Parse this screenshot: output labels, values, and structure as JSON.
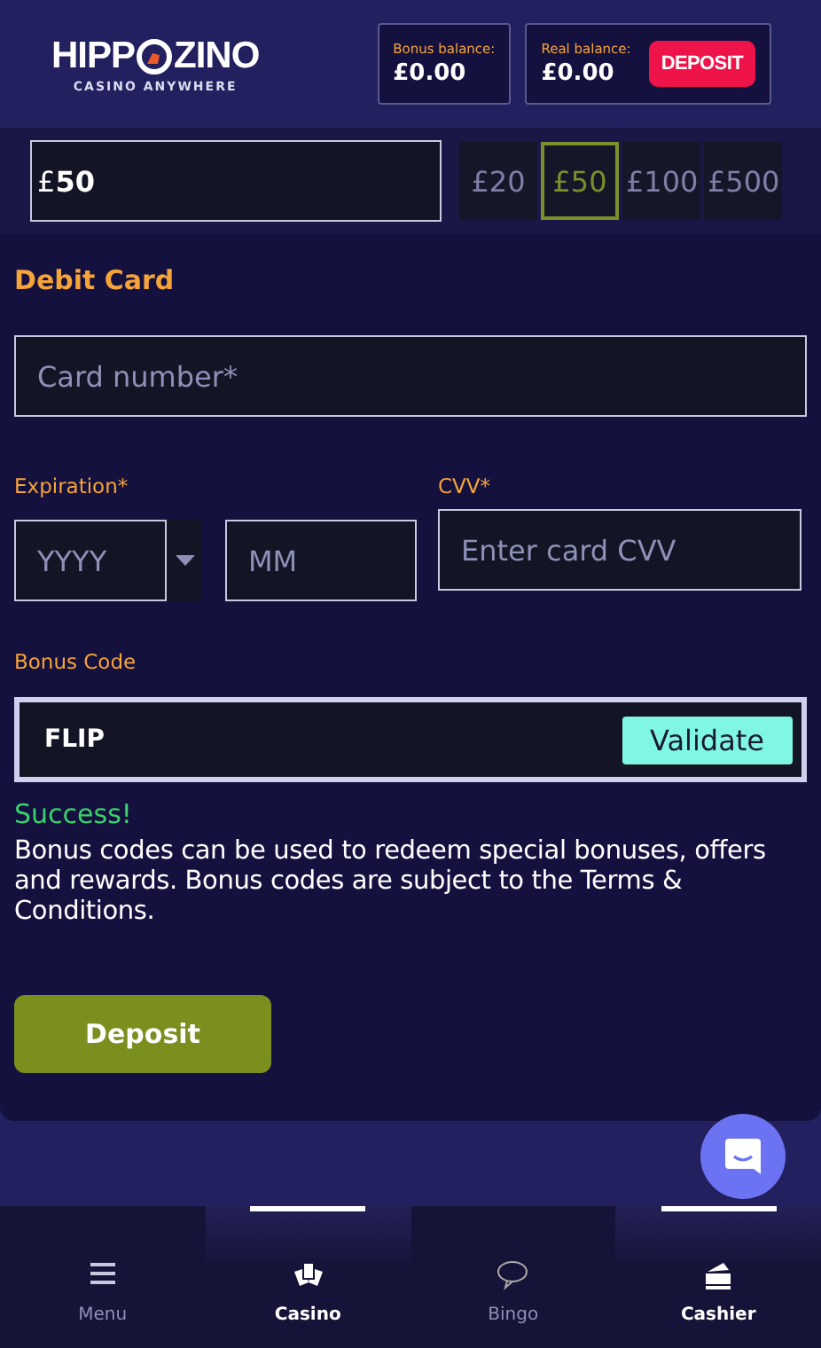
{
  "header": {
    "logo": {
      "before": "HIPP",
      "after": "ZINO",
      "tagline": "CASINO ANYWHERE"
    },
    "balances": [
      {
        "label": "Bonus balance:",
        "value": "£0.00"
      },
      {
        "label": "Real balance:",
        "value": "£0.00"
      }
    ],
    "deposit_button": "DEPOSIT"
  },
  "amount": {
    "currency": "£",
    "value": "50",
    "presets": [
      {
        "label": "£20",
        "selected": false
      },
      {
        "label": "£50",
        "selected": true
      },
      {
        "label": "£100",
        "selected": false
      },
      {
        "label": "£500",
        "selected": false
      }
    ]
  },
  "form": {
    "title": "Debit Card",
    "card_number": {
      "placeholder": "Card number*"
    },
    "expiration": {
      "label": "Expiration*",
      "year": {
        "placeholder": "YYYY"
      },
      "month": {
        "placeholder": "MM"
      }
    },
    "cvv": {
      "label": "CVV*",
      "placeholder": "Enter card CVV"
    },
    "bonus": {
      "label": "Bonus Code",
      "value": "FLIP",
      "button": "Validate"
    },
    "status": "Success!",
    "note": "Bonus codes can be used to redeem special bonuses, offers and rewards. Bonus codes are subject to the Terms & Conditions.",
    "submit": "Deposit"
  },
  "nav": [
    {
      "kind": "menu",
      "label": "Menu",
      "selected": false
    },
    {
      "kind": "casino",
      "label": "Casino",
      "selected": true
    },
    {
      "kind": "bingo",
      "label": "Bingo",
      "selected": false
    },
    {
      "kind": "cashier",
      "label": "Cashier",
      "selected": true
    }
  ]
}
